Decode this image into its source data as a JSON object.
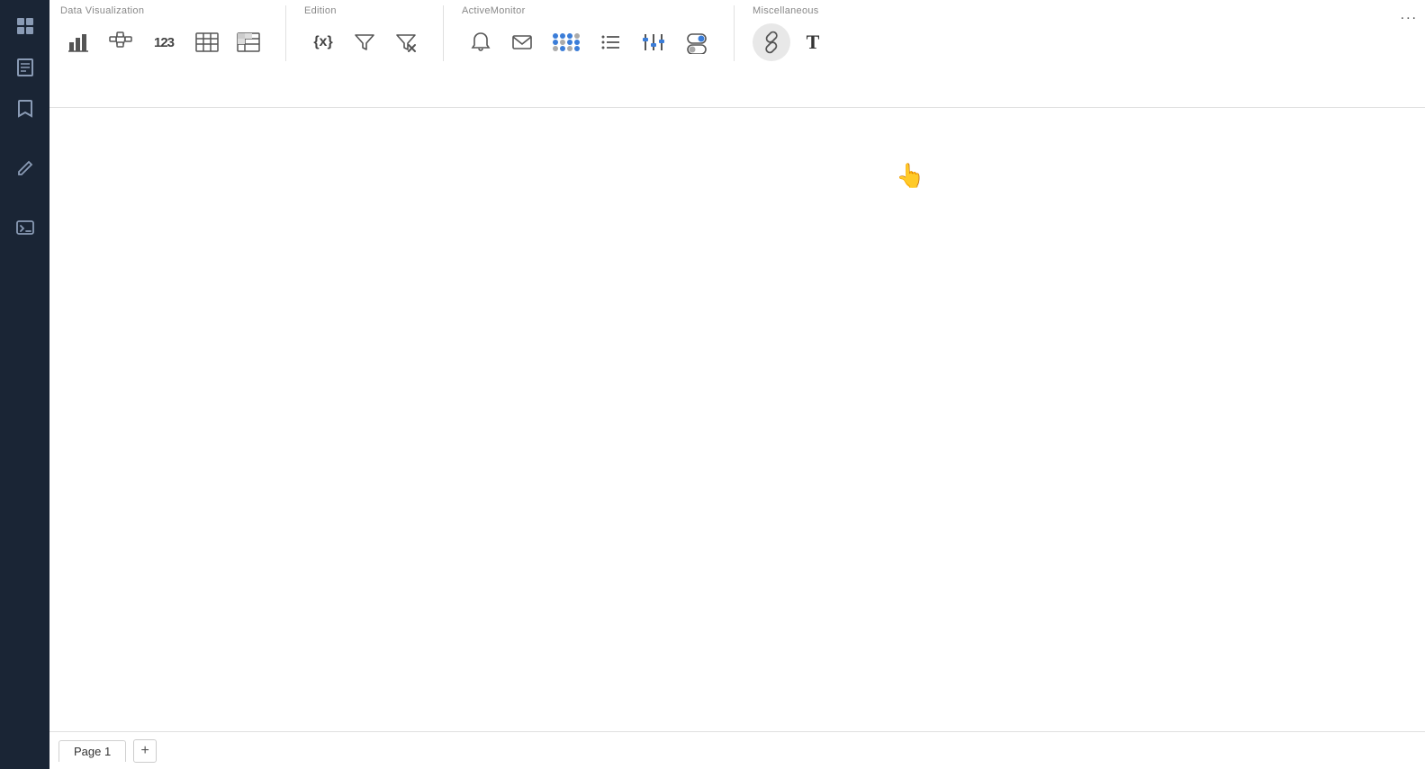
{
  "sidebar": {
    "icons": [
      {
        "name": "grid-icon",
        "symbol": "⊞"
      },
      {
        "name": "page-icon",
        "symbol": "☰"
      },
      {
        "name": "bookmark-icon",
        "symbol": "🔖"
      },
      {
        "name": "edit-icon",
        "symbol": "✎"
      },
      {
        "name": "terminal-icon",
        "symbol": "⌨"
      }
    ]
  },
  "toolbar": {
    "groups": [
      {
        "label": "Data Visualization",
        "name": "data-visualization",
        "tools": [
          {
            "name": "bar-chart-icon",
            "title": "Bar Chart"
          },
          {
            "name": "network-icon",
            "title": "Network"
          },
          {
            "name": "number-icon",
            "title": "Number"
          },
          {
            "name": "table-icon",
            "title": "Table"
          },
          {
            "name": "pivot-icon",
            "title": "Pivot Table"
          }
        ]
      },
      {
        "label": "Edition",
        "name": "edition",
        "tools": [
          {
            "name": "variable-icon",
            "title": "Variable"
          },
          {
            "name": "filter-icon",
            "title": "Filter"
          },
          {
            "name": "filter-remove-icon",
            "title": "Remove Filter"
          }
        ]
      },
      {
        "label": "ActiveMonitor",
        "name": "active-monitor",
        "tools": [
          {
            "name": "alert-icon",
            "title": "Alert"
          },
          {
            "name": "email-icon",
            "title": "Email"
          },
          {
            "name": "dot-matrix-icon",
            "title": "Dot Matrix"
          },
          {
            "name": "list-icon",
            "title": "List"
          },
          {
            "name": "slider-icon",
            "title": "Slider"
          },
          {
            "name": "toggle-icon",
            "title": "Toggle"
          }
        ]
      },
      {
        "label": "Miscellaneous",
        "name": "miscellaneous",
        "tools": [
          {
            "name": "link-icon",
            "title": "Link",
            "hovered": true
          },
          {
            "name": "text-icon",
            "title": "Text"
          }
        ]
      }
    ]
  },
  "bottom_bar": {
    "page_label": "Page 1",
    "add_label": "+"
  },
  "more_options": "..."
}
